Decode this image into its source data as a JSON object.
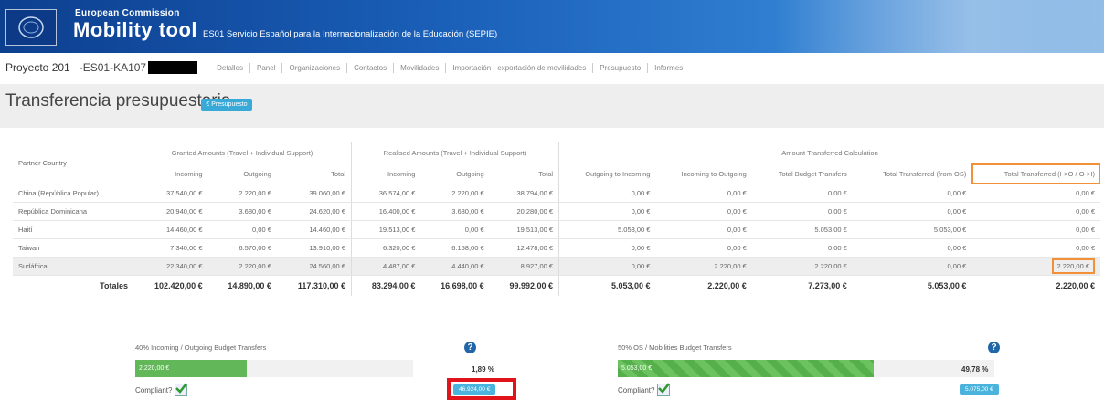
{
  "header": {
    "ec_label": "European Commission",
    "app_title": "Mobility tool",
    "org": "ES01 Servicio Español para la Internacionalización de la Educación (SEPIE)"
  },
  "project": {
    "label": "Proyecto 201",
    "code": "-ES01-KA107",
    "tabs": [
      "Detalles",
      "Panel",
      "Organizaciones",
      "Contactos",
      "Movilidades",
      "Importación - exportación de movilidades",
      "Presupuesto",
      "Informes"
    ]
  },
  "page": {
    "title": "Transferencia presupuestaria",
    "badge": "€ Presupuesto"
  },
  "table": {
    "partner_country_header": "Partner Country",
    "group_headers": [
      "Granted Amounts (Travel + Individual Support)",
      "Realised Amounts (Travel + Individual Support)",
      "Amount Transferred Calculation"
    ],
    "sub_headers": [
      "Incoming",
      "Outgoing",
      "Total",
      "Incoming",
      "Outgoing",
      "Total",
      "Outgoing to Incoming",
      "Incoming to Outgoing",
      "Total Budget Transfers",
      "Total Transferred (from OS)",
      "Total Transferred (I->O / O->I)"
    ],
    "rows": [
      {
        "country": "China (República Popular)",
        "values": [
          "37.540,00 €",
          "2.220,00 €",
          "39.060,00 €",
          "36.574,00 €",
          "2.220,00 €",
          "38.794,00 €",
          "0,00 €",
          "0,00 €",
          "0,00 €",
          "0,00 €",
          "0,00 €"
        ]
      },
      {
        "country": "República Dominicana",
        "values": [
          "20.940,00 €",
          "3.680,00 €",
          "24.620,00 €",
          "16.400,00 €",
          "3.680,00 €",
          "20.280,00 €",
          "0,00 €",
          "0,00 €",
          "0,00 €",
          "0,00 €",
          "0,00 €"
        ]
      },
      {
        "country": "Haití",
        "values": [
          "14.460,00 €",
          "0,00 €",
          "14.460,00 €",
          "19.513,00 €",
          "0,00 €",
          "19.513,00 €",
          "5.053,00 €",
          "0,00 €",
          "5.053,00 €",
          "5.053,00 €",
          "0,00 €"
        ]
      },
      {
        "country": "Taiwan",
        "values": [
          "7.340,00 €",
          "6.570,00 €",
          "13.910,00 €",
          "6.320,00 €",
          "6.158,00 €",
          "12.478,00 €",
          "0,00 €",
          "0,00 €",
          "0,00 €",
          "0,00 €",
          "0,00 €"
        ]
      },
      {
        "country": "Sudáfrica",
        "values": [
          "22.340,00 €",
          "2.220,00 €",
          "24.560,00 €",
          "4.487,00 €",
          "4.440,00 €",
          "8.927,00 €",
          "0,00 €",
          "2.220,00 €",
          "2.220,00 €",
          "0,00 €",
          "2.220,00 €"
        ]
      }
    ],
    "totals_label": "Totales",
    "totals": [
      "102.420,00 €",
      "14.890,00 €",
      "117.310,00 €",
      "83.294,00 €",
      "16.698,00 €",
      "99.992,00 €",
      "5.053,00 €",
      "2.220,00 €",
      "7.273,00 €",
      "5.053,00 €",
      "2.220,00 €"
    ]
  },
  "panels": [
    {
      "title": "40% Incoming / Outgoing Budget Transfers",
      "bar_label": "2.220,00 €",
      "fill_fraction": 0.4,
      "percent": "1,89 %",
      "compliant": "Compliant?",
      "amount": "46.924,00 €"
    },
    {
      "title": "50% OS / Mobilities Budget Transfers",
      "bar_label": "5.053,00 €",
      "fill_fraction": 0.4,
      "percent": "49,78 %",
      "compliant": "Compliant?",
      "amount": "5.075,00 €"
    }
  ],
  "colors": {
    "accent_orange": "#f29037",
    "highlight_red": "#e2141b",
    "progress_green": "#62b758",
    "badge_blue": "#49b3dd"
  }
}
